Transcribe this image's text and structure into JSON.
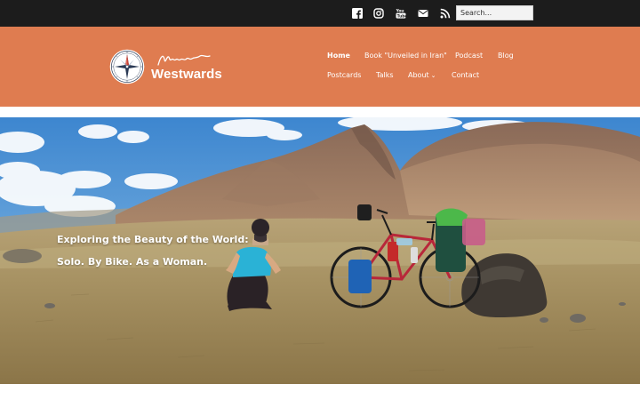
{
  "topbar": {
    "social": [
      "facebook-icon",
      "instagram-icon",
      "youtube-icon",
      "email-icon",
      "rss-icon"
    ],
    "search_placeholder": "Search..."
  },
  "header": {
    "brand": "Westwards",
    "nav": [
      {
        "label": "Home",
        "active": true
      },
      {
        "label": "Book \"Unveiled in Iran\"",
        "active": false
      },
      {
        "label": "Podcast",
        "active": false
      },
      {
        "label": "Blog",
        "active": false
      },
      {
        "label": "Postcards",
        "active": false
      },
      {
        "label": "Talks",
        "active": false
      },
      {
        "label": "About",
        "active": false,
        "has_submenu": true
      },
      {
        "label": "Contact",
        "active": false
      }
    ]
  },
  "hero": {
    "line1": "Exploring the Beauty of the World:",
    "line2": "Solo. By Bike. As a Woman."
  },
  "colors": {
    "topbar": "#1c1c1c",
    "header": "#df7c50",
    "text": "#ffffff"
  }
}
